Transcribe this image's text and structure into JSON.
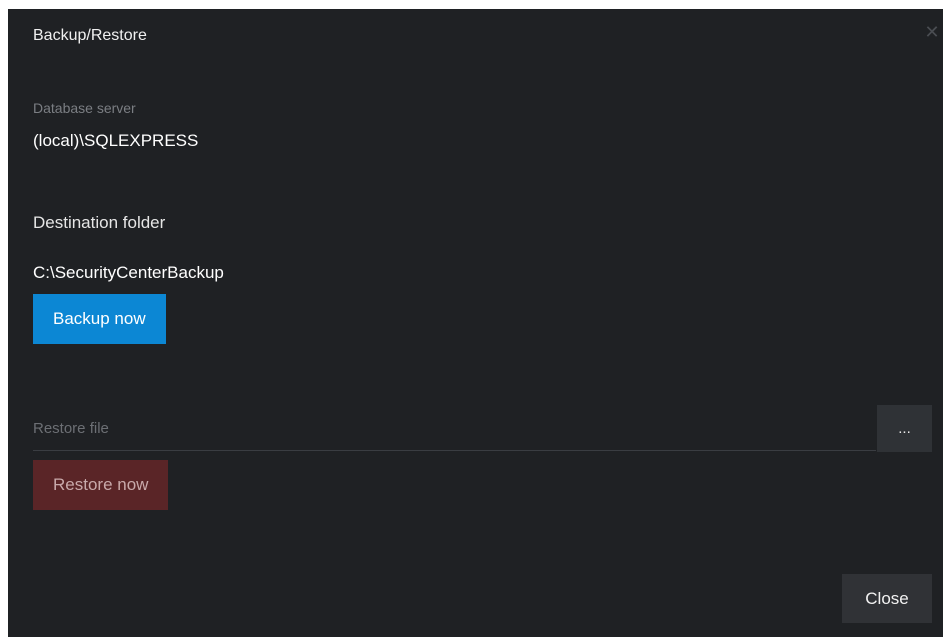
{
  "dialog": {
    "title": "Backup/Restore",
    "close_icon": "close-icon"
  },
  "database": {
    "label": "Database server",
    "value": "(local)\\SQLEXPRESS"
  },
  "destination": {
    "label": "Destination folder",
    "value": "C:\\SecurityCenterBackup",
    "backup_button": "Backup now"
  },
  "restore": {
    "placeholder": "Restore file",
    "browse_button": "...",
    "restore_button": "Restore now"
  },
  "footer": {
    "close_button": "Close"
  },
  "colors": {
    "dialog_bg": "#1f2124",
    "backup_button": "#0c87d4",
    "restore_button": "#5a2527",
    "close_button": "#303236"
  }
}
